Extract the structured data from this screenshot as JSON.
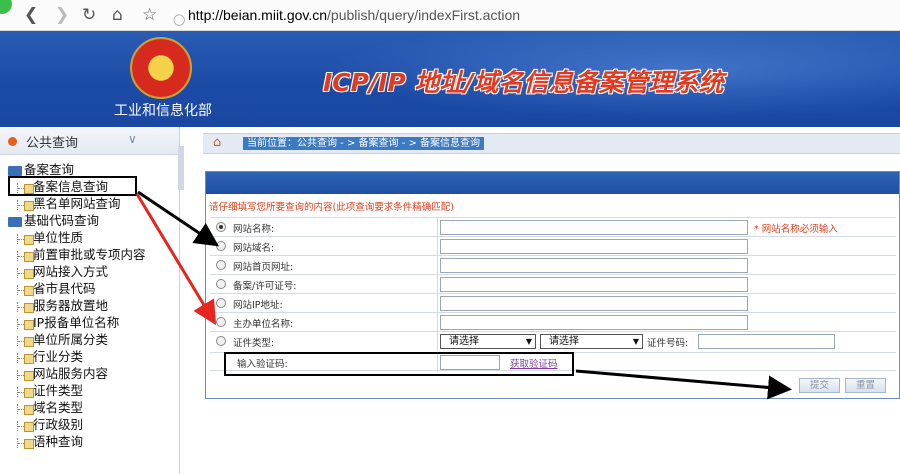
{
  "browser": {
    "url_domain": "http://beian.miit.gov.cn",
    "url_path": "/publish/query/indexFirst.action",
    "icons": [
      "back-icon",
      "forward-icon",
      "reload-icon",
      "home-icon",
      "star-icon",
      "shield-icon",
      "lock-icon"
    ]
  },
  "header": {
    "department": "工业和信息化部",
    "system_title": "ICP/IP 地址/域名信息备案管理系统"
  },
  "sidebar": {
    "heading": "公共查询",
    "tree": [
      {
        "label": "备案查询",
        "type": "folder"
      },
      {
        "label": "备案信息查询",
        "type": "leaf",
        "selected": true
      },
      {
        "label": "黑名单网站查询",
        "type": "leaf"
      },
      {
        "label": "基础代码查询",
        "type": "folder"
      },
      {
        "label": "单位性质",
        "type": "leaf"
      },
      {
        "label": "前置审批或专项内容",
        "type": "leaf"
      },
      {
        "label": "网站接入方式",
        "type": "leaf"
      },
      {
        "label": "省市县代码",
        "type": "leaf"
      },
      {
        "label": "服务器放置地",
        "type": "leaf"
      },
      {
        "label": "IP报备单位名称",
        "type": "leaf"
      },
      {
        "label": "单位所属分类",
        "type": "leaf"
      },
      {
        "label": "行业分类",
        "type": "leaf"
      },
      {
        "label": "网站服务内容",
        "type": "leaf"
      },
      {
        "label": "证件类型",
        "type": "leaf"
      },
      {
        "label": "域名类型",
        "type": "leaf"
      },
      {
        "label": "行政级别",
        "type": "leaf"
      },
      {
        "label": "语种查询",
        "type": "leaf"
      }
    ]
  },
  "breadcrumb": {
    "text": "当前位置：公共查询 - > 备案查询 - > 备案信息查询"
  },
  "form": {
    "note": "请仔细填写您所要查询的内容(此项查询要求条件精确匹配)",
    "fields": [
      {
        "label": "网站名称:",
        "selected": true,
        "required_note": "* 网站名称必须输入"
      },
      {
        "label": "网站域名:",
        "selected": false
      },
      {
        "label": "网站首页网址:",
        "selected": false
      },
      {
        "label": "备案/许可证号:",
        "selected": false
      },
      {
        "label": "网站IP地址:",
        "selected": false
      },
      {
        "label": "主办单位名称:",
        "selected": false
      }
    ],
    "cert_row": {
      "label": "证件类型:",
      "select1": "请选择",
      "select2": "请选择",
      "certno_label": "证件号码:"
    },
    "captcha": {
      "label": "输入验证码:",
      "link": "获取验证码"
    },
    "submit_label": "提交",
    "reset_label": "重置"
  },
  "colors": {
    "banner_blue": "#1b4aa6",
    "title_red": "#e23a20",
    "note_red": "#e0401c",
    "annotation_red": "#e5251f"
  }
}
